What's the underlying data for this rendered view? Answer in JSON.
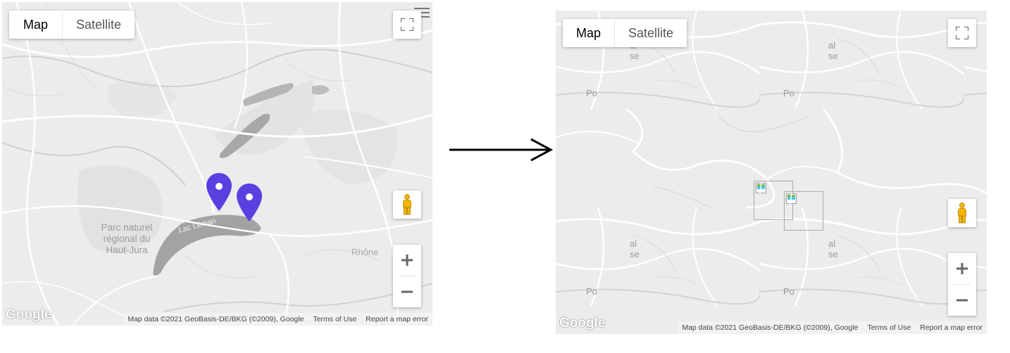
{
  "left_map": {
    "map_button": "Map",
    "satellite_button": "Satellite",
    "labels": {
      "park_line1": "Parc naturel",
      "park_line2": "régional du",
      "park_line3": "Haut-Jura",
      "lake": "Lac Léman",
      "river": "Rhône"
    },
    "google_logo": "Google",
    "attribution": {
      "map_data": "Map data ©2021 GeoBasis-DE/BKG (©2009), Google",
      "terms": "Terms of Use",
      "report": "Report a map error"
    },
    "zoom_in": "+",
    "zoom_out": "−",
    "marker_color": "#5b3fe0"
  },
  "right_map": {
    "map_button": "Map",
    "satellite_button": "Satellite",
    "tile_label_fragments": {
      "po": "Po",
      "al": "al",
      "se": "se"
    },
    "google_logo": "Google",
    "attribution": {
      "map_data": "Map data ©2021 GeoBasis-DE/BKG (©2009), Google",
      "terms": "Terms of Use",
      "report": "Report a map error"
    },
    "zoom_in": "+",
    "zoom_out": "−"
  },
  "colors": {
    "map_background": "#ececec",
    "roads": "#ffffff",
    "borders": "#c9c9c9",
    "water": "#9a9a9a",
    "pegman": "#f5b400"
  },
  "icons": [
    "fullscreen-icon",
    "pegman-icon",
    "map-marker-icon",
    "broken-image-icon",
    "hamburger-menu-icon",
    "right-arrow-icon"
  ]
}
